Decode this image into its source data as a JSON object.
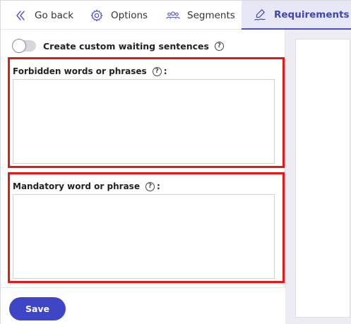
{
  "tabs": {
    "back": {
      "label": "Go back",
      "icon": "double-chevron-left-icon"
    },
    "options": {
      "label": "Options",
      "icon": "gear-icon"
    },
    "segments": {
      "label": "Segments",
      "icon": "users-icon"
    },
    "requirements": {
      "label": "Requirements",
      "icon": "signature-icon",
      "active": true
    }
  },
  "toggle": {
    "label": "Create custom waiting sentences",
    "on": false
  },
  "forbidden": {
    "label": "Forbidden words or phrases",
    "colon": ":",
    "value": ""
  },
  "mandatory": {
    "label": "Mandatory word or phrase",
    "colon": ":",
    "value": ""
  },
  "footer": {
    "save_label": "Save"
  },
  "help_glyph": "?",
  "colors": {
    "accent": "#3f46c6",
    "active_tab_bg": "#e7e8f7",
    "highlight_border": "#e81717"
  }
}
